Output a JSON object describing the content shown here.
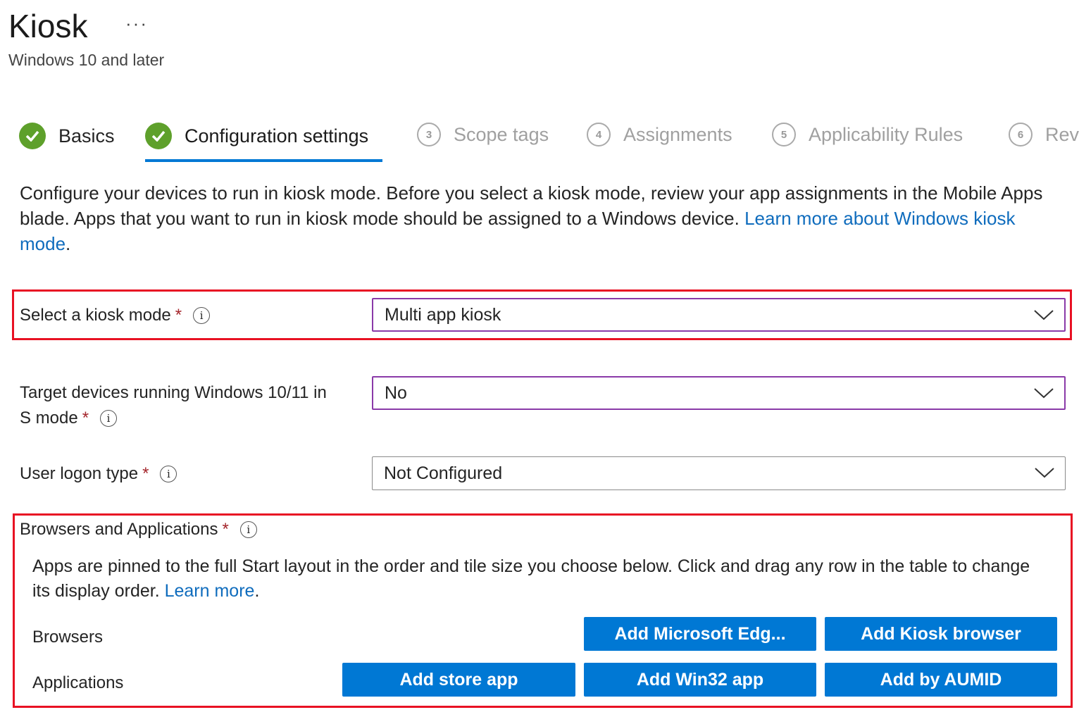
{
  "header": {
    "title": "Kiosk",
    "more": "···",
    "subtitle": "Windows 10 and later"
  },
  "steps": [
    {
      "label": "Basics",
      "state": "done"
    },
    {
      "label": "Configuration settings",
      "state": "active"
    },
    {
      "num": "3",
      "label": "Scope tags"
    },
    {
      "num": "4",
      "label": "Assignments"
    },
    {
      "num": "5",
      "label": "Applicability Rules"
    },
    {
      "num": "6",
      "label": "Revi"
    }
  ],
  "intro": {
    "text": "Configure your devices to run in kiosk mode. Before you select a kiosk mode, review your app assignments in the Mobile Apps blade. Apps that you want to run in kiosk mode should be assigned to a Windows device. ",
    "link": "Learn more about Windows kiosk mode",
    "end": "."
  },
  "fields": {
    "kiosk_mode": {
      "label": "Select a kiosk mode",
      "value": "Multi app kiosk"
    },
    "s_mode": {
      "label1": "Target devices running Windows 10/11 in",
      "label2": "S mode",
      "value": "No"
    },
    "logon": {
      "label": "User logon type",
      "value": "Not Configured"
    }
  },
  "required": "*",
  "info": "i",
  "apps": {
    "label": "Browsers and Applications",
    "desc": "Apps are pinned to the full Start layout in the order and tile size you choose below. Click and drag any row in the table to change its display order. ",
    "link": "Learn more",
    "end": ".",
    "browsers_label": "Browsers",
    "applications_label": "Applications",
    "buttons": {
      "edge": "Add Microsoft Edg...",
      "kiosk_browser": "Add Kiosk browser",
      "store": "Add store app",
      "win32": "Add Win32 app",
      "aumid": "Add by AUMID"
    }
  },
  "colors": {
    "accent": "#0078d4",
    "highlight": "#e81123",
    "success": "#5ea02b"
  }
}
